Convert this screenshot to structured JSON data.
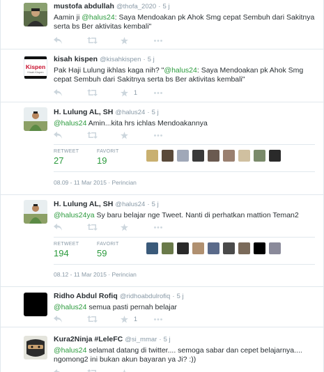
{
  "tweets": [
    {
      "fullname": "mustofa abdullah",
      "username": "@thofa_2020",
      "time": "5 j",
      "text_pre": "Aamin ji ",
      "mention": "@halus24",
      "text_post": ": Saya Mendoakan pk Ahok Smg cepat Sembuh dari Sakitnya serta bs Ber aktivitas kembali\"",
      "avatar_color": "#4a5a3a"
    },
    {
      "fullname": "kisah kispen",
      "username": "@kisahkispen",
      "time": "5 j",
      "text_pre": "Pak Haji Lulung ikhlas kaga nih? \"",
      "mention": "@halus24",
      "text_post": ": Saya Mendoakan pk Ahok Smg cepat Sembuh dari Sakitnya serta bs Ber aktivitas kembali\"",
      "favorite_count": "1",
      "avatar_logo": "Kispen",
      "avatar_sub": "Kisah Kispen",
      "avatar_color": "#c8102e"
    },
    {
      "fullname": "H. Lulung AL, SH",
      "username": "@halus24",
      "time": "5 j",
      "mention": "@halus24",
      "text_post": " Amin...kita hrs ichlas Mendoakannya",
      "retweet_label": "RETWEET",
      "retweet_count": "27",
      "favorite_label": "FAVORIT",
      "favorite_count": "19",
      "meta": "08.09 - 11 Mar 2015 · Perincian",
      "avatar_color": "#6f8f4a"
    },
    {
      "fullname": "H. Lulung AL, SH",
      "username": "@halus24",
      "time": "5 j",
      "mention": "@halus24ya",
      "text_post": " Sy baru belajar nge Tweet. Nanti di perhatkan mattion Teman2",
      "retweet_label": "RETWEET",
      "retweet_count": "194",
      "favorite_label": "FAVORIT",
      "favorite_count": "59",
      "meta": "08.12 - 11 Mar 2015 · Perincian",
      "avatar_color": "#6f8f4a"
    },
    {
      "fullname": "Ridho Abdul Rofiq",
      "username": "@ridhoabdulrofiq",
      "time": "5 j",
      "mention": "@halus24",
      "text_post": " semua pasti pernah belajar",
      "favorite_count": "1",
      "avatar_color": "#000000"
    },
    {
      "fullname": "Kura2Ninja #LeleFC",
      "username": "@si_mmar",
      "time": "5 j",
      "mention": "@halus24",
      "text_post": " selamat datang di twitter....  semoga sabar dan cepet belajarnya.... ngomong2 ini bukan akun bayaran ya Ji? :))",
      "avatar_color": "#d8d8d0"
    }
  ],
  "faces_a": [
    "#c9b070",
    "#5a4a3a",
    "#a0a8b8",
    "#3a3a3a",
    "#6a5a50",
    "#9a8070",
    "#d0c0a0",
    "#7a8a6a",
    "#2a2a2a"
  ],
  "faces_b": [
    "#3a5a7a",
    "#6a7a4a",
    "#2a2a2a",
    "#b09070",
    "#5a6a8a",
    "#4a4a4a",
    "#7a6a5a",
    "#000000",
    "#8a8a9a"
  ],
  "colors": {
    "mention": "#2a9a3c",
    "meta": "#8899a6",
    "action": "#ccd6dd"
  },
  "icons": [
    "reply-icon",
    "retweet-icon",
    "favorite-icon",
    "more-icon"
  ]
}
